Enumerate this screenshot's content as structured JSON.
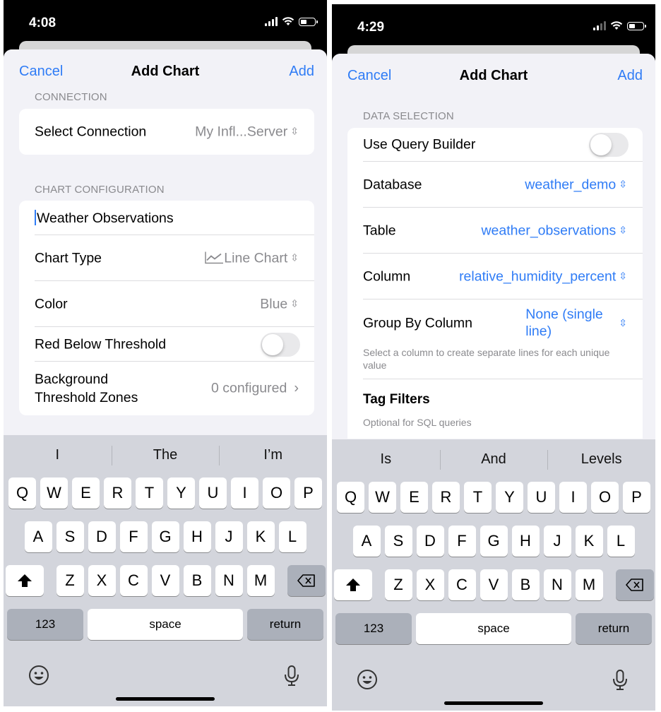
{
  "left": {
    "status_time": "4:08",
    "nav": {
      "cancel": "Cancel",
      "title": "Add Chart",
      "add": "Add"
    },
    "connection_section": "CONNECTION",
    "select_connection": {
      "label": "Select Connection",
      "value": "My Infl...Server"
    },
    "chart_config_section": "CHART CONFIGURATION",
    "chart_name": "Weather Observations",
    "chart_type": {
      "label": "Chart Type",
      "value": "Line Chart"
    },
    "color": {
      "label": "Color",
      "value": "Blue"
    },
    "red_below": {
      "label": "Red Below Threshold",
      "on": false
    },
    "background_zones": {
      "label_line1": "Background",
      "label_line2": "Threshold Zones",
      "value": "0 configured"
    },
    "suggestions": [
      "I",
      "The",
      "I’m"
    ]
  },
  "right": {
    "status_time": "4:29",
    "nav": {
      "cancel": "Cancel",
      "title": "Add Chart",
      "add": "Add"
    },
    "data_section": "DATA SELECTION",
    "use_query_builder": {
      "label": "Use Query Builder",
      "on": false
    },
    "database": {
      "label": "Database",
      "value": "weather_demo"
    },
    "table": {
      "label": "Table",
      "value": "weather_observations"
    },
    "column": {
      "label": "Column",
      "value": "relative_humidity_percent"
    },
    "group_by": {
      "label": "Group By Column",
      "value_line1": "None (single",
      "value_line2": "line)",
      "help": "Select a column to create separate lines for each unique value"
    },
    "tag_filters": {
      "title": "Tag Filters",
      "help": "Optional for SQL queries"
    },
    "suggestions": [
      "Is",
      "And",
      "Levels"
    ]
  },
  "keyboard": {
    "row1": [
      "Q",
      "W",
      "E",
      "R",
      "T",
      "Y",
      "U",
      "I",
      "O",
      "P"
    ],
    "row2": [
      "A",
      "S",
      "D",
      "F",
      "G",
      "H",
      "J",
      "K",
      "L"
    ],
    "row3": [
      "Z",
      "X",
      "C",
      "V",
      "B",
      "N",
      "M"
    ],
    "numbers": "123",
    "space": "space",
    "return": "return"
  },
  "colors": {
    "accent": "#2f7cf6",
    "background": "#f2f2f7",
    "keyboard": "#d3d5dc"
  }
}
